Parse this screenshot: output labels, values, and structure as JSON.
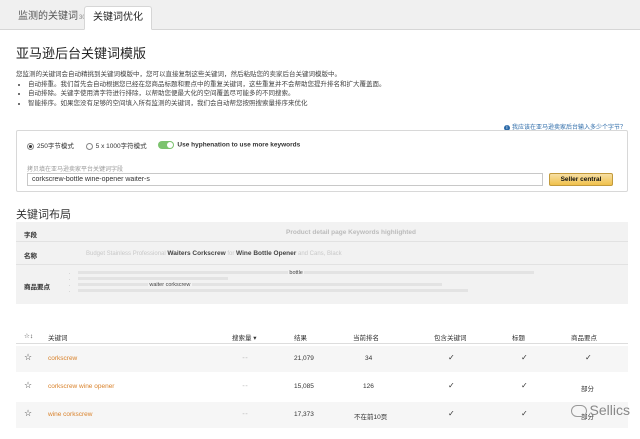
{
  "tabs": [
    {
      "label": "监测的关键词",
      "badge": "30"
    },
    {
      "label": "关键词优化",
      "badge": ""
    }
  ],
  "header": {
    "title": "亚马逊后台关键词模版"
  },
  "intro": {
    "text": "您监测的关键词会自动精挑到关键词模版中，您可以直接复制这些关键词，然后粘贴您的卖家后台关键词模版中。",
    "bullets": [
      "自动排重。我们首先会自动根据您已经在您商品标题和要点中的重复关键词，这些重复并不会帮助您提升排名和扩大覆盖面。",
      "自动排除。关键字使用清字符进行排除，以帮助您便最大化的空间覆盖尽可能多的不同搜索。",
      "智能排序。如果您没有足够的空间填入所有监测的关键词，我们会自动帮您按照搜索量排序来优化"
    ]
  },
  "help_link": "我应该在亚马逊卖家后台输入多少个字节？",
  "options": {
    "opt1": "250字节模式",
    "opt2": "5 x 1000字符模式",
    "toggle_label": "Use hyphenation to use more keywords",
    "hint": "拷贝填在亚马逊卖家平台关键词字段",
    "keywords_value": "corkscrew-bottle wine-opener waiter-s",
    "seller_button": "Seller central"
  },
  "layout": {
    "title": "关键词布局",
    "row1_label": "字段",
    "row1_text": "Product detail page Keywords highlighted",
    "row2_label": "名称",
    "row2_pre": "Budget Stainless Professional",
    "row2_k1": "Waiters Corkscrew",
    "row2_mid": "for",
    "row2_k2": "Wine Bottle Opener",
    "row2_post": "and Cans, Black",
    "row3_label": "商品要点",
    "bullet1_kw": "bottle",
    "bullet3_kw": "waiter corkscrew"
  },
  "table": {
    "headers": [
      "关键词",
      "搜索量",
      "结果",
      "当前排名",
      "包含关键词",
      "标题",
      "商品要点"
    ],
    "rows": [
      {
        "keyword": "corkscrew",
        "results": "21,079",
        "rank": "34",
        "included": "✓",
        "title": "✓",
        "bullets": "✓"
      },
      {
        "keyword": "corkscrew wine opener",
        "results": "15,085",
        "rank": "126",
        "included": "✓",
        "title": "✓",
        "bullets": "部分"
      },
      {
        "keyword": "wine corkscrew",
        "results": "17,373",
        "rank": "不在前10页",
        "included": "✓",
        "title": "✓",
        "bullets": "部分"
      }
    ]
  },
  "watermark": "Sellics"
}
